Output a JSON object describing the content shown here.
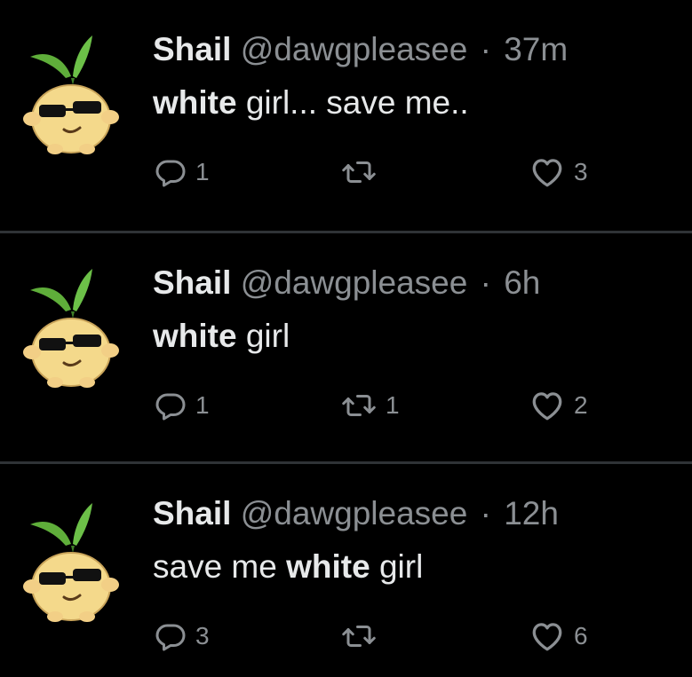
{
  "tweets": [
    {
      "name": "Shail",
      "handle": "@dawgpleasee",
      "separator": "·",
      "time": "37m",
      "segments": [
        {
          "text": "white",
          "bold": true
        },
        {
          "text": " girl... save me..",
          "bold": false
        }
      ],
      "replies": "1",
      "retweets": "",
      "likes": "3"
    },
    {
      "name": "Shail",
      "handle": "@dawgpleasee",
      "separator": "·",
      "time": "6h",
      "segments": [
        {
          "text": "white",
          "bold": true
        },
        {
          "text": " girl",
          "bold": false
        }
      ],
      "replies": "1",
      "retweets": "1",
      "likes": "2"
    },
    {
      "name": "Shail",
      "handle": "@dawgpleasee",
      "separator": "·",
      "time": "12h",
      "segments": [
        {
          "text": "save me ",
          "bold": false
        },
        {
          "text": "white",
          "bold": true
        },
        {
          "text": " girl",
          "bold": false
        }
      ],
      "replies": "3",
      "retweets": "",
      "likes": "6"
    }
  ],
  "icons": {
    "avatar": "onion-sprout-avatar-icon",
    "reply": "reply-bubble-icon",
    "retweet": "retweet-arrows-icon",
    "like": "heart-icon"
  },
  "colors": {
    "background": "#000000",
    "primary_text": "#e7e9ea",
    "secondary_text": "#8b8f93",
    "divider": "#2f3336",
    "avatar_body": "#f4d98b",
    "avatar_leaf": "#5fae3a"
  }
}
